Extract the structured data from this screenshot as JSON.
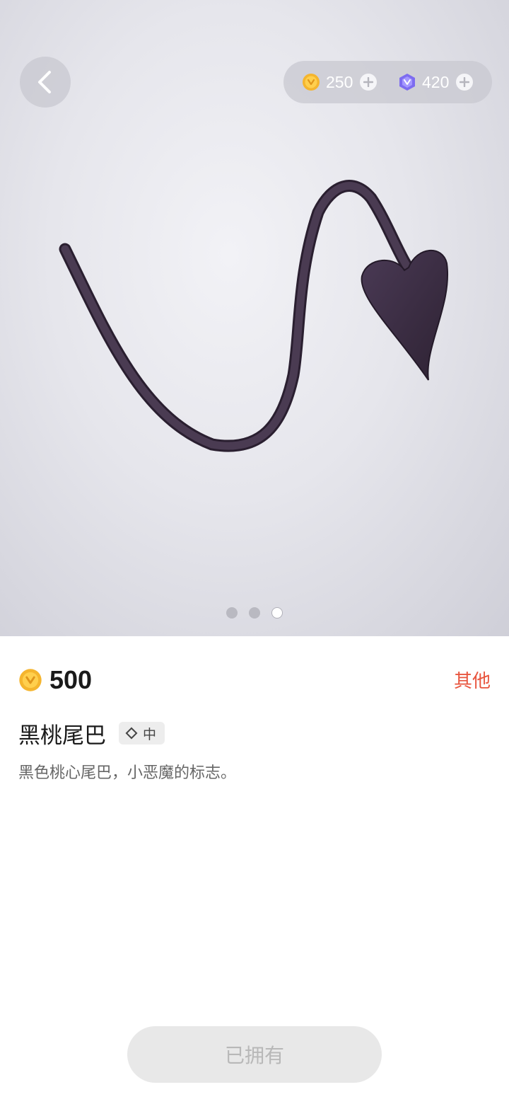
{
  "header": {
    "back_icon": "chevron-left-icon",
    "coins": {
      "icon": "gold-coin-icon",
      "value": "250"
    },
    "gems": {
      "icon": "purple-gem-icon",
      "value": "420"
    }
  },
  "preview": {
    "item_visual": "black-devil-heart-tail",
    "carousel": {
      "total": 3,
      "active_index": 2
    }
  },
  "item": {
    "price": "500",
    "price_icon": "gold-coin-icon",
    "category": "其他",
    "name": "黑桃尾巴",
    "size_tag": "中",
    "description": "黑色桃心尾巴，小恶魔的标志。"
  },
  "action": {
    "label": "已拥有"
  },
  "colors": {
    "accent": "#e8553e",
    "tail": "#3b2c44",
    "coin": "#f5b52e",
    "gem": "#7d6cf0"
  }
}
